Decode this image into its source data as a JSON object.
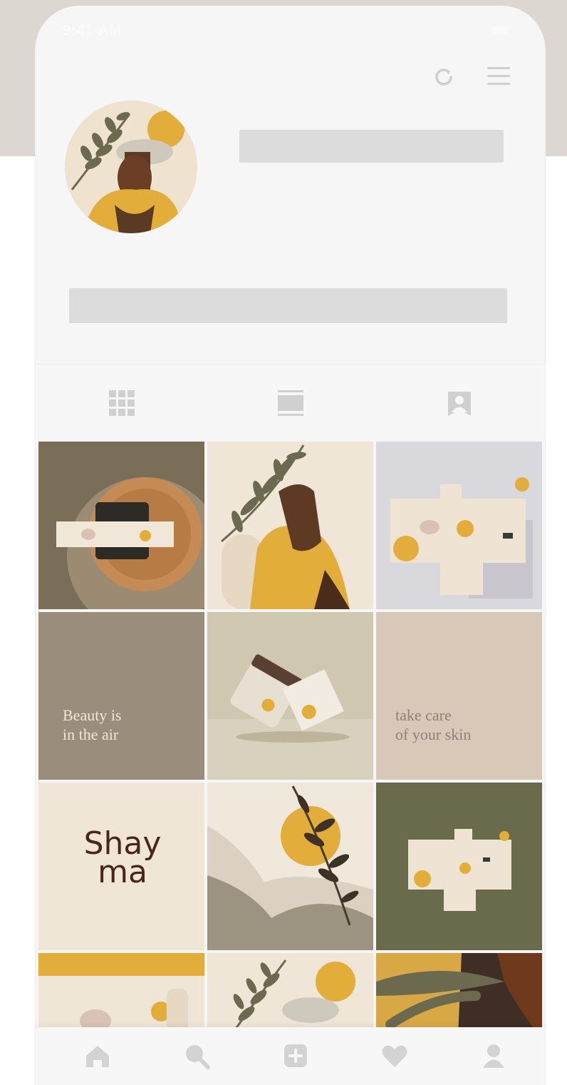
{
  "status_bar": {
    "time": "9:41 AM"
  },
  "profile": {
    "name_placeholder": "",
    "bio_placeholder": ""
  },
  "tabs": [
    {
      "name": "grid",
      "icon": "grid-icon",
      "active": true
    },
    {
      "name": "feed",
      "icon": "feed-icon",
      "active": false
    },
    {
      "name": "tagged",
      "icon": "tagged-icon",
      "active": false
    }
  ],
  "posts": [
    {
      "id": "tile-1",
      "kind": "photo",
      "text": ""
    },
    {
      "id": "tile-2",
      "kind": "illustration",
      "text": ""
    },
    {
      "id": "tile-3",
      "kind": "photo",
      "text": ""
    },
    {
      "id": "tile-4",
      "kind": "text",
      "text": "Beauty is\nin the air"
    },
    {
      "id": "tile-5",
      "kind": "photo",
      "text": ""
    },
    {
      "id": "tile-6",
      "kind": "text",
      "text": "take care\nof your skin"
    },
    {
      "id": "tile-7",
      "kind": "logo",
      "text": "Shay\nma"
    },
    {
      "id": "tile-8",
      "kind": "illustration",
      "text": ""
    },
    {
      "id": "tile-9",
      "kind": "photo",
      "text": ""
    },
    {
      "id": "tile-10",
      "kind": "photo",
      "text": ""
    },
    {
      "id": "tile-11",
      "kind": "illustration",
      "text": ""
    },
    {
      "id": "tile-12",
      "kind": "illustration",
      "text": ""
    }
  ],
  "bottom_nav": [
    {
      "name": "home",
      "icon": "home-icon"
    },
    {
      "name": "search",
      "icon": "search-icon"
    },
    {
      "name": "add",
      "icon": "add-post-icon"
    },
    {
      "name": "activity",
      "icon": "heart-icon"
    },
    {
      "name": "profile",
      "icon": "profile-icon"
    }
  ],
  "colors": {
    "background_band": "#dcd8d1",
    "phone_bg": "#f6f6f6",
    "placeholder": "#dcdcdc",
    "icon_gray": "#cfcfcf",
    "mustard": "#e3ad3a",
    "olive": "#6a6a4c",
    "taupe": "#9b8d7b",
    "beige": "#efe6d8"
  }
}
